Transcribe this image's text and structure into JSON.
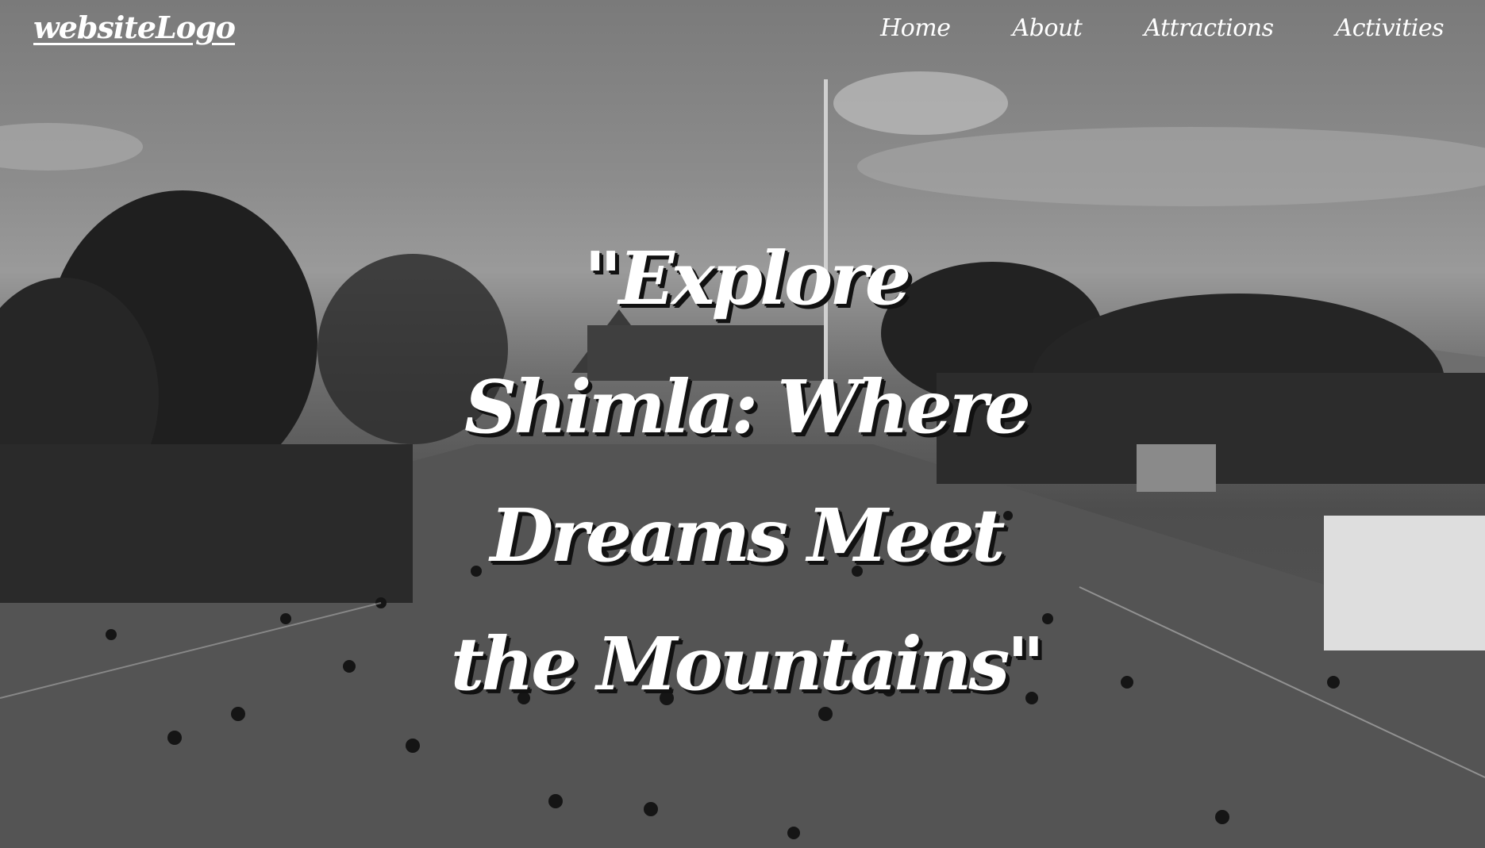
{
  "brand": {
    "logo_text": "websiteLogo"
  },
  "nav": {
    "items": [
      {
        "label": "Home"
      },
      {
        "label": "About"
      },
      {
        "label": "Attractions"
      },
      {
        "label": "Activities"
      }
    ]
  },
  "hero": {
    "headline": "\"Explore Shimla: Where Dreams Meet the Mountains\"",
    "background_description_icon": "shimla-ridge-photo",
    "tint": "grayscale"
  },
  "colors": {
    "text": "#ffffff",
    "shadow": "#111111",
    "overlay": "#5a5a5a"
  }
}
